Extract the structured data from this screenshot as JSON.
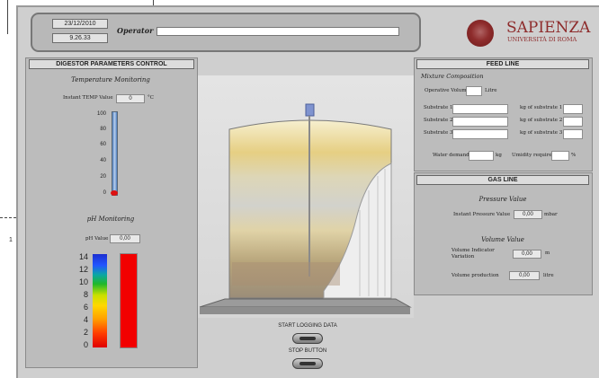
{
  "header": {
    "date": "23/12/2010",
    "time": "9.26.33",
    "operator_label": "Operator",
    "operator_value": "",
    "brand_name": "SAPIENZA",
    "brand_sub": "UNIVERSITÀ DI ROMA"
  },
  "digestor": {
    "title": "DIGESTOR PARAMETERS CONTROL",
    "temp_title": "Temperature Monitoring",
    "temp_label": "Instant TEMP Value",
    "temp_value": "0",
    "temp_unit": "°C",
    "temp_ticks": [
      "100",
      "80",
      "60",
      "40",
      "20",
      "0"
    ],
    "temp_level": 0,
    "ph_title": "pH Monitoring",
    "ph_label": "pH Value",
    "ph_value": "0,00",
    "ph_ticks": [
      "14",
      "12",
      "10",
      "8",
      "6",
      "4",
      "2",
      "0"
    ]
  },
  "feed": {
    "title": "FEED LINE",
    "mixture_title": "Mixture Composition",
    "op_volume_label": "Operative Volume",
    "op_volume_unit": "Litre",
    "substrate_labels": [
      "Substrate 1",
      "Substrate 2",
      "Substrate 3"
    ],
    "kg_labels": [
      "kg of substrate 1",
      "kg of substrate 2",
      "kg of substrate 3"
    ],
    "water_label": "Water demand",
    "water_unit": "kg",
    "humidity_label": "Umidity required",
    "humidity_unit": "%"
  },
  "gas": {
    "title": "GAS LINE",
    "pressure_title": "Pressure Value",
    "pressure_label": "Instant Pressure Value",
    "pressure_value": "0,00",
    "pressure_unit": "mbar",
    "volume_title": "Volume Value",
    "vol_indicator_label_1": "Volume Indicator",
    "vol_indicator_label_2": "Variation",
    "vol_indicator_value": "0,00",
    "vol_indicator_unit": "m",
    "vol_production_label": "Volume production",
    "vol_production_value": "0,00",
    "vol_production_unit": "litre"
  },
  "controls": {
    "start_label": "START LOGGING DATA",
    "stop_label": "STOP BUTTON"
  },
  "side_mark": "1"
}
